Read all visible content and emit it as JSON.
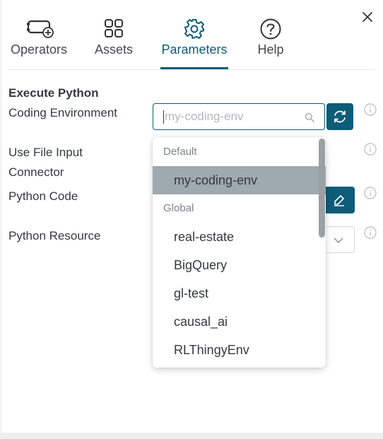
{
  "tabs": [
    {
      "label": "Operators",
      "icon": "operators-add-icon"
    },
    {
      "label": "Assets",
      "icon": "grid-icon"
    },
    {
      "label": "Parameters",
      "icon": "gear-icon",
      "active": true
    },
    {
      "label": "Help",
      "icon": "help-circle-icon"
    }
  ],
  "section": {
    "title": "Execute Python"
  },
  "fields": {
    "coding_environment": "Coding Environment",
    "use_file_input_line1": "Use File Input",
    "use_file_input_line2": "Connector",
    "python_code": "Python Code",
    "python_resource": "Python Resource"
  },
  "env_search": {
    "placeholder": "my-coding-env",
    "value": ""
  },
  "dropdown": {
    "groups": [
      {
        "label": "Default",
        "items": [
          "my-coding-env"
        ]
      },
      {
        "label": "Global",
        "items": [
          "real-estate",
          "BigQuery",
          "gl-test",
          "causal_ai",
          "RLThingyEnv"
        ]
      }
    ],
    "selected": "my-coding-env"
  },
  "colors": {
    "accent": "#0d5c78",
    "selected_bg": "#9eaab0",
    "text": "#333a40"
  }
}
